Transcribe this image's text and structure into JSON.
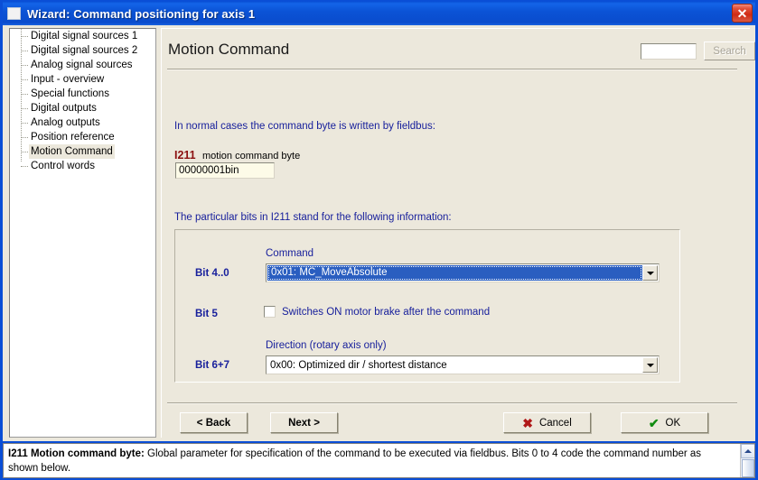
{
  "window": {
    "title": "Wizard: Command positioning for axis 1",
    "icon": "window-icon",
    "close_label": "✕"
  },
  "sidebar": {
    "items": [
      {
        "label": "Digital signal sources 1",
        "selected": false
      },
      {
        "label": "Digital signal sources 2",
        "selected": false
      },
      {
        "label": "Analog signal sources",
        "selected": false
      },
      {
        "label": "Input - overview",
        "selected": false
      },
      {
        "label": "Special functions",
        "selected": false
      },
      {
        "label": "Digital outputs",
        "selected": false
      },
      {
        "label": "Analog outputs",
        "selected": false
      },
      {
        "label": "Position reference",
        "selected": false
      },
      {
        "label": "Motion Command",
        "selected": true
      },
      {
        "label": "Control words",
        "selected": false
      }
    ]
  },
  "header": {
    "title": "Motion Command",
    "search_value": "",
    "search_placeholder": "",
    "search_button_label": "Search"
  },
  "main": {
    "intro_text": "In normal cases the command byte is written by fieldbus:",
    "parameter": {
      "code": "I211",
      "description": "motion command byte",
      "value": "00000001bin"
    },
    "bits_intro_text": "The particular bits in I211 stand for the following information:",
    "groupbox": {
      "rows": [
        {
          "bit_label": "Bit 4..0",
          "caption": "Command",
          "value": "0x01: MC_MoveAbsolute"
        },
        {
          "bit_label": "Bit 5",
          "checkbox_label": "Switches ON motor brake after the command",
          "checked": false
        },
        {
          "bit_label": "Bit 6+7",
          "caption": "Direction (rotary axis only)",
          "value": "0x00: Optimized dir / shortest distance"
        }
      ]
    }
  },
  "buttons": {
    "back": "< Back",
    "next": "Next >",
    "cancel": "Cancel",
    "cancel_glyph": "✖",
    "ok": "OK",
    "ok_glyph": "✔"
  },
  "statusbar": {
    "param_title": "I211  Motion command byte:",
    "text": " Global parameter for specification of the command to be executed via fieldbus. Bits 0 to 4 code the command number as shown below."
  },
  "colors": {
    "titlebar_blue": "#0b53d6",
    "window_bg": "#ece8dc",
    "label_blue": "#18209c",
    "param_red": "#8c1010",
    "selection_blue": "#2a5ec0",
    "input_yellow": "#fdfbe8",
    "close_red": "#cf2a13"
  }
}
